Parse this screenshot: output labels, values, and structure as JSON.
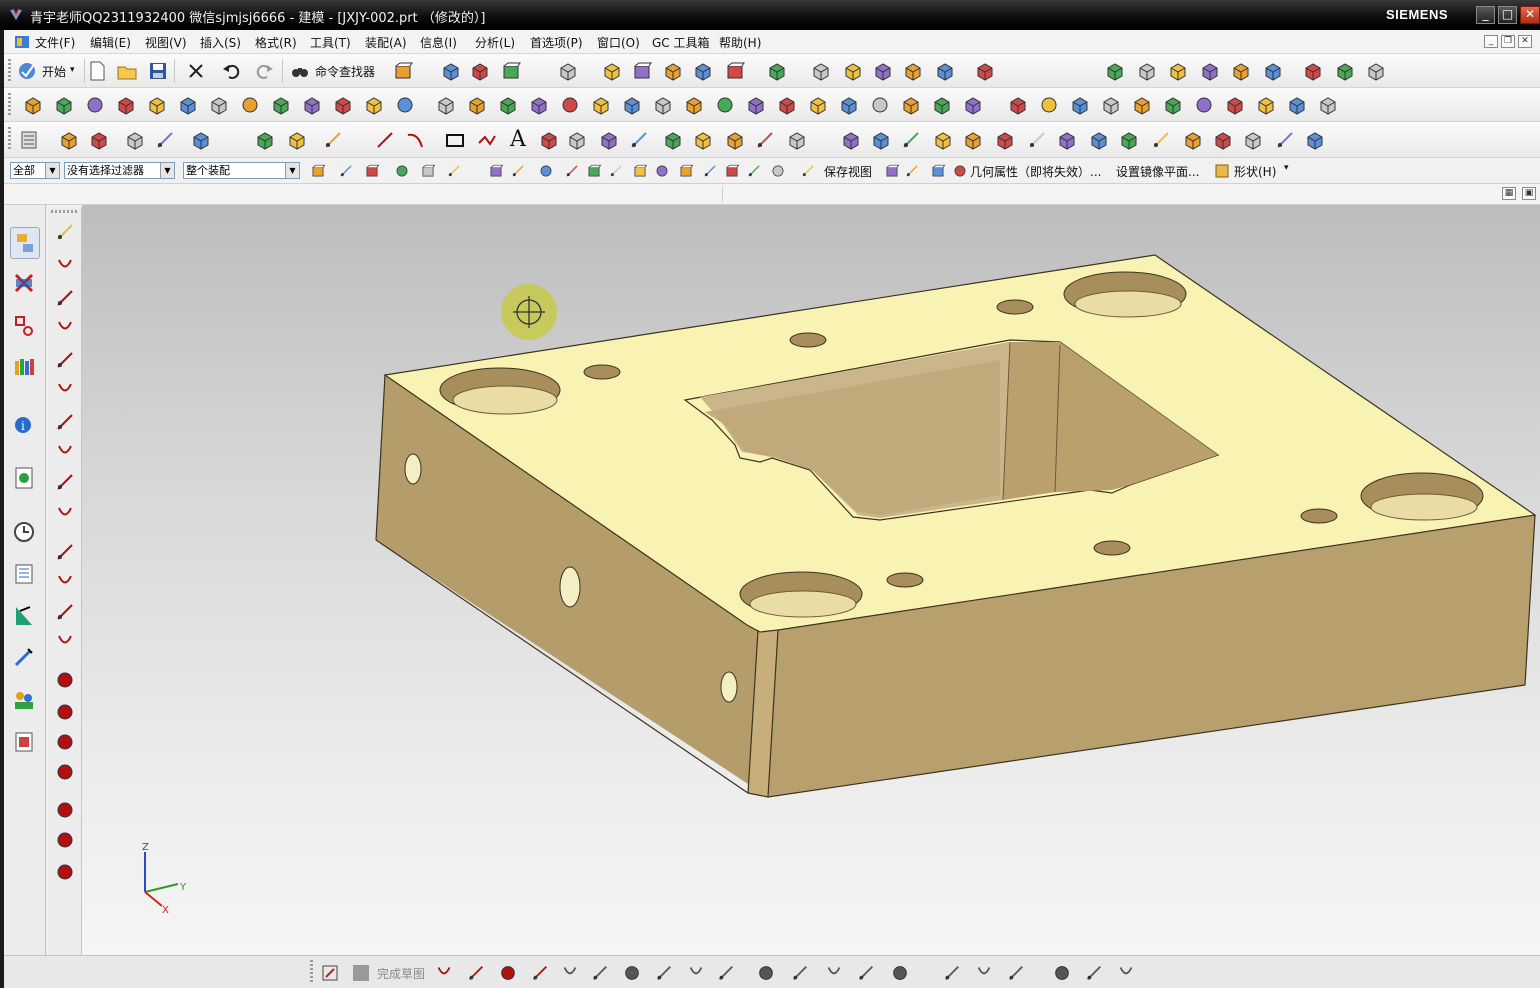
{
  "window": {
    "title": "青宇老师QQ2311932400 微信sjmjsj6666 - 建模 - [JXJY-002.prt （修改的）]",
    "brand": "SIEMENS",
    "controls": {
      "minimize": "_",
      "maximize": "□",
      "close": "✕"
    }
  },
  "menu": {
    "items": [
      "文件(F)",
      "编辑(E)",
      "视图(V)",
      "插入(S)",
      "格式(R)",
      "工具(T)",
      "装配(A)",
      "信息(I)",
      "分析(L)",
      "首选项(P)",
      "窗口(O)",
      "GC 工具箱",
      "帮助(H)"
    ]
  },
  "standard_toolbar": {
    "start_label": "开始",
    "command_finder_label": "命令查找器"
  },
  "selection_bar": {
    "scope": "全部",
    "filter": "没有选择过滤器",
    "assembly_scope": "整个装配",
    "save_view_label": "保存视图",
    "geometry_props_label": "几何属性（即将失效）...",
    "mirror_plane_label": "设置镜像平面...",
    "shape_label": "形状(H)"
  },
  "sketch_bar": {
    "finish_label": "完成草图"
  },
  "triad": {
    "x": "X",
    "y": "Y",
    "z": "Z"
  },
  "colors": {
    "part_top": "#f7f0b2",
    "part_front": "#b99f6c",
    "part_side": "#d9c28a",
    "viewport_top": "#bdbdbd",
    "viewport_bottom": "#f5f5f5",
    "cursor_highlight": "#c8c93a",
    "titlebar": "#0d0d0d"
  },
  "icons": [
    "new-icon",
    "open-icon",
    "save-icon",
    "cut-icon",
    "undo-icon",
    "redo-icon",
    "binoculars-icon",
    "fit-icon",
    "zoom-icon",
    "rotate-icon",
    "cube-icon",
    "line-icon",
    "arc-icon",
    "rectangle-icon",
    "circle-icon",
    "text-icon",
    "point-icon"
  ]
}
